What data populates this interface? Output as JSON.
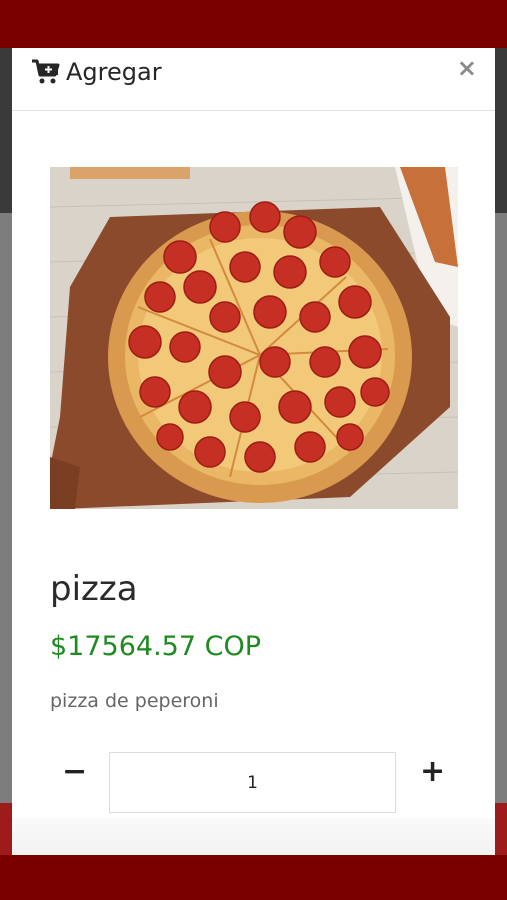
{
  "modal": {
    "title": "Agregar",
    "close_label": "×",
    "cart_icon": "cart-plus-icon"
  },
  "product": {
    "name": "pizza",
    "price": "$17564.57 COP",
    "description": "pizza de peperoni",
    "image": "pepperoni-pizza-image"
  },
  "quantity": {
    "minus_label": "−",
    "value": "1",
    "plus_label": "+"
  },
  "colors": {
    "header_red": "#7a0000",
    "footer_red": "#9e1b1b",
    "price_green": "#1f8a1f"
  }
}
